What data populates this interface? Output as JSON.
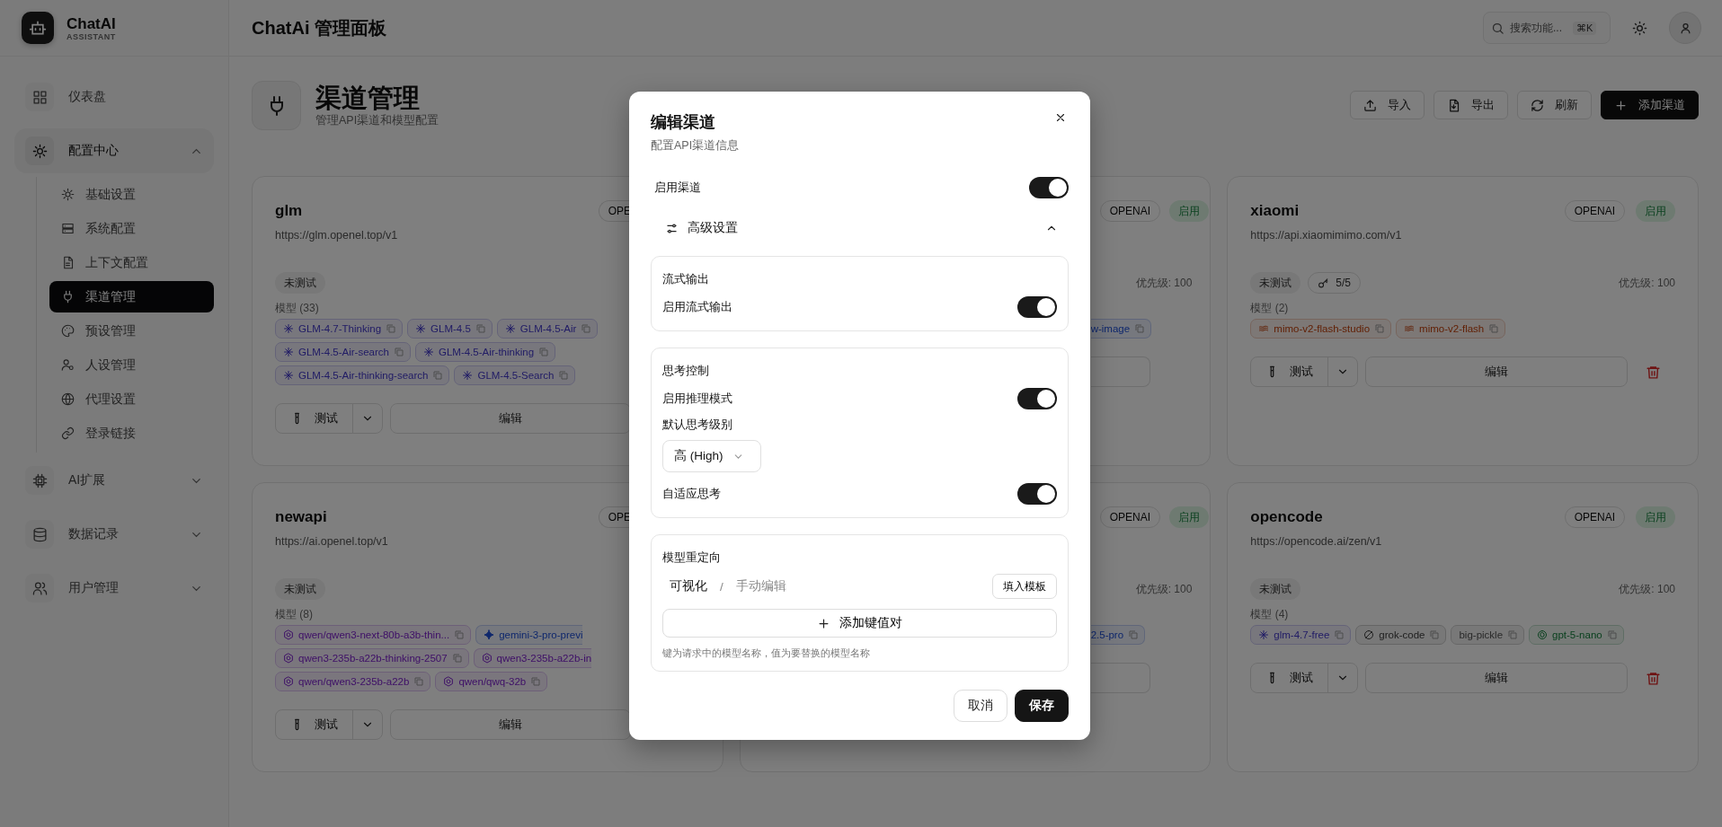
{
  "app": {
    "name": "ChatAI",
    "tagline": "ASSISTANT"
  },
  "sidebar": {
    "items": [
      {
        "label": "仪表盘",
        "selected": false
      },
      {
        "label": "配置中心",
        "selected": false,
        "expanded": true,
        "children": [
          {
            "label": "基础设置",
            "selected": false
          },
          {
            "label": "系统配置",
            "selected": false
          },
          {
            "label": "上下文配置",
            "selected": false
          },
          {
            "label": "渠道管理",
            "selected": true
          },
          {
            "label": "预设管理",
            "selected": false
          },
          {
            "label": "人设管理",
            "selected": false
          },
          {
            "label": "代理设置",
            "selected": false
          },
          {
            "label": "登录链接",
            "selected": false
          }
        ]
      },
      {
        "label": "AI扩展",
        "selected": false,
        "expanded": false
      },
      {
        "label": "数据记录",
        "selected": false,
        "expanded": false
      },
      {
        "label": "用户管理",
        "selected": false,
        "expanded": false
      }
    ]
  },
  "header": {
    "title": "ChatAi 管理面板",
    "search": {
      "placeholder": "搜索功能...",
      "shortcut": "⌘K"
    }
  },
  "page": {
    "title": "渠道管理",
    "subtitle": "管理API渠道和模型配置",
    "actions": [
      {
        "label": "导入",
        "kind": "outline"
      },
      {
        "label": "导出",
        "kind": "outline"
      },
      {
        "label": "刷新",
        "kind": "outline"
      },
      {
        "label": "添加渠道",
        "kind": "primary"
      }
    ]
  },
  "cards": [
    {
      "kind": "left_clipped",
      "name": "glm",
      "url": "https://glm.openel.top/v1",
      "type_badge": "OPE",
      "test_status": "未测试",
      "models_label": "模型 (33)",
      "test_label": "测试",
      "edit_label": "编辑",
      "models": [
        {
          "name": "GLM-4.7-Thinking",
          "kind": "zhipu",
          "clipped": false
        },
        {
          "name": "GLM-4.5",
          "kind": "zhipu",
          "clipped": false
        },
        {
          "name": "GLM-4.5-Air",
          "kind": "zhipu",
          "clipped": false
        },
        {
          "name": "GLM-4.5-Air-search",
          "kind": "zhipu",
          "clipped": false
        },
        {
          "name": "GLM-4.5-Air-thinking",
          "kind": "zhipu",
          "clipped": false
        },
        {
          "name": "GLM-4.5-Air-thinking-search",
          "kind": "zhipu",
          "clipped": false
        },
        {
          "name": "GLM-4.5-Search",
          "kind": "zhipu",
          "clipped": false
        }
      ]
    },
    {
      "kind": "right_clipped",
      "type_badge": "OPENAI",
      "status_badge": "启用",
      "priority": "优先级: 100",
      "models": [
        {
          "name": "w-image",
          "kind": "gemini",
          "clipped": true
        }
      ]
    },
    {
      "kind": "full",
      "name": "xiaomi",
      "url": "https://api.xiaomimimo.com/v1",
      "type_badge": "OPENAI",
      "status_badge": "启用",
      "test_status": "未测试",
      "key_count": "5/5",
      "priority": "优先级: 100",
      "models_label": "模型 (2)",
      "test_label": "测试",
      "edit_label": "编辑",
      "models": [
        {
          "name": "mimo-v2-flash-studio",
          "kind": "mimo",
          "clipped": false
        },
        {
          "name": "mimo-v2-flash",
          "kind": "mimo",
          "clipped": false
        }
      ]
    },
    {
      "kind": "left_clipped",
      "name": "newapi",
      "url": "https://ai.openel.top/v1",
      "type_badge": "OPE",
      "test_status": "未测试",
      "models_label": "模型 (8)",
      "test_label": "测试",
      "edit_label": "编辑",
      "models": [
        {
          "name": "qwen/qwen3-next-80b-a3b-thin...",
          "kind": "qwen",
          "clipped": false
        },
        {
          "name": "gemini-3-pro-previ",
          "kind": "gemini",
          "clipped": true
        },
        {
          "name": "qwen3-235b-a22b-thinking-2507",
          "kind": "qwen",
          "clipped": false
        },
        {
          "name": "qwen3-235b-a22b-in",
          "kind": "qwen",
          "clipped": true
        },
        {
          "name": "qwen/qwen3-235b-a22b",
          "kind": "qwen",
          "clipped": false
        },
        {
          "name": "qwen/qwq-32b",
          "kind": "qwen",
          "clipped": false
        }
      ]
    },
    {
      "kind": "right_clipped",
      "type_badge": "OPENAI",
      "status_badge": "启用",
      "priority": "优先级: 100",
      "models": [
        {
          "name": "2.5-pro",
          "kind": "gemini",
          "clipped": true
        }
      ]
    },
    {
      "kind": "full",
      "name": "opencode",
      "url": "https://opencode.ai/zen/v1",
      "type_badge": "OPENAI",
      "status_badge": "启用",
      "test_status": "未测试",
      "priority": "优先级: 100",
      "models_label": "模型 (4)",
      "test_label": "测试",
      "edit_label": "编辑",
      "models": [
        {
          "name": "glm-4.7-free",
          "kind": "zhipu",
          "clipped": false
        },
        {
          "name": "grok-code",
          "kind": "grok",
          "clipped": false
        },
        {
          "name": "big-pickle",
          "kind": "plain",
          "clipped": false
        },
        {
          "name": "gpt-5-nano",
          "kind": "openai",
          "clipped": false
        }
      ]
    }
  ],
  "modal": {
    "title": "编辑渠道",
    "subtitle": "配置API渠道信息",
    "enable": {
      "label": "启用渠道",
      "on": true
    },
    "advanced": {
      "label": "高级设置",
      "expanded": true
    },
    "sections": [
      {
        "title": "流式输出",
        "rows": [
          {
            "kind": "toggle",
            "label": "启用流式输出",
            "on": true
          }
        ]
      },
      {
        "title": "思考控制",
        "rows": [
          {
            "kind": "toggle",
            "label": "启用推理模式",
            "on": true
          },
          {
            "kind": "select",
            "label": "默认思考级别",
            "value": "高 (High)"
          },
          {
            "kind": "toggle",
            "label": "自适应思考",
            "on": true
          }
        ]
      },
      {
        "title": "模型重定向",
        "rows": [
          {
            "kind": "mapping",
            "tabs": [
              {
                "label": "可视化",
                "selected": true
              },
              {
                "label": "手动编辑",
                "selected": false
              }
            ],
            "separator": "/",
            "template_button": "填入模板",
            "add_button": "添加键值对",
            "hint": "键为请求中的模型名称，值为要替换的模型名称"
          }
        ]
      }
    ],
    "buttons": [
      {
        "label": "取消",
        "kind": "secondary"
      },
      {
        "label": "保存",
        "kind": "primary"
      }
    ]
  }
}
